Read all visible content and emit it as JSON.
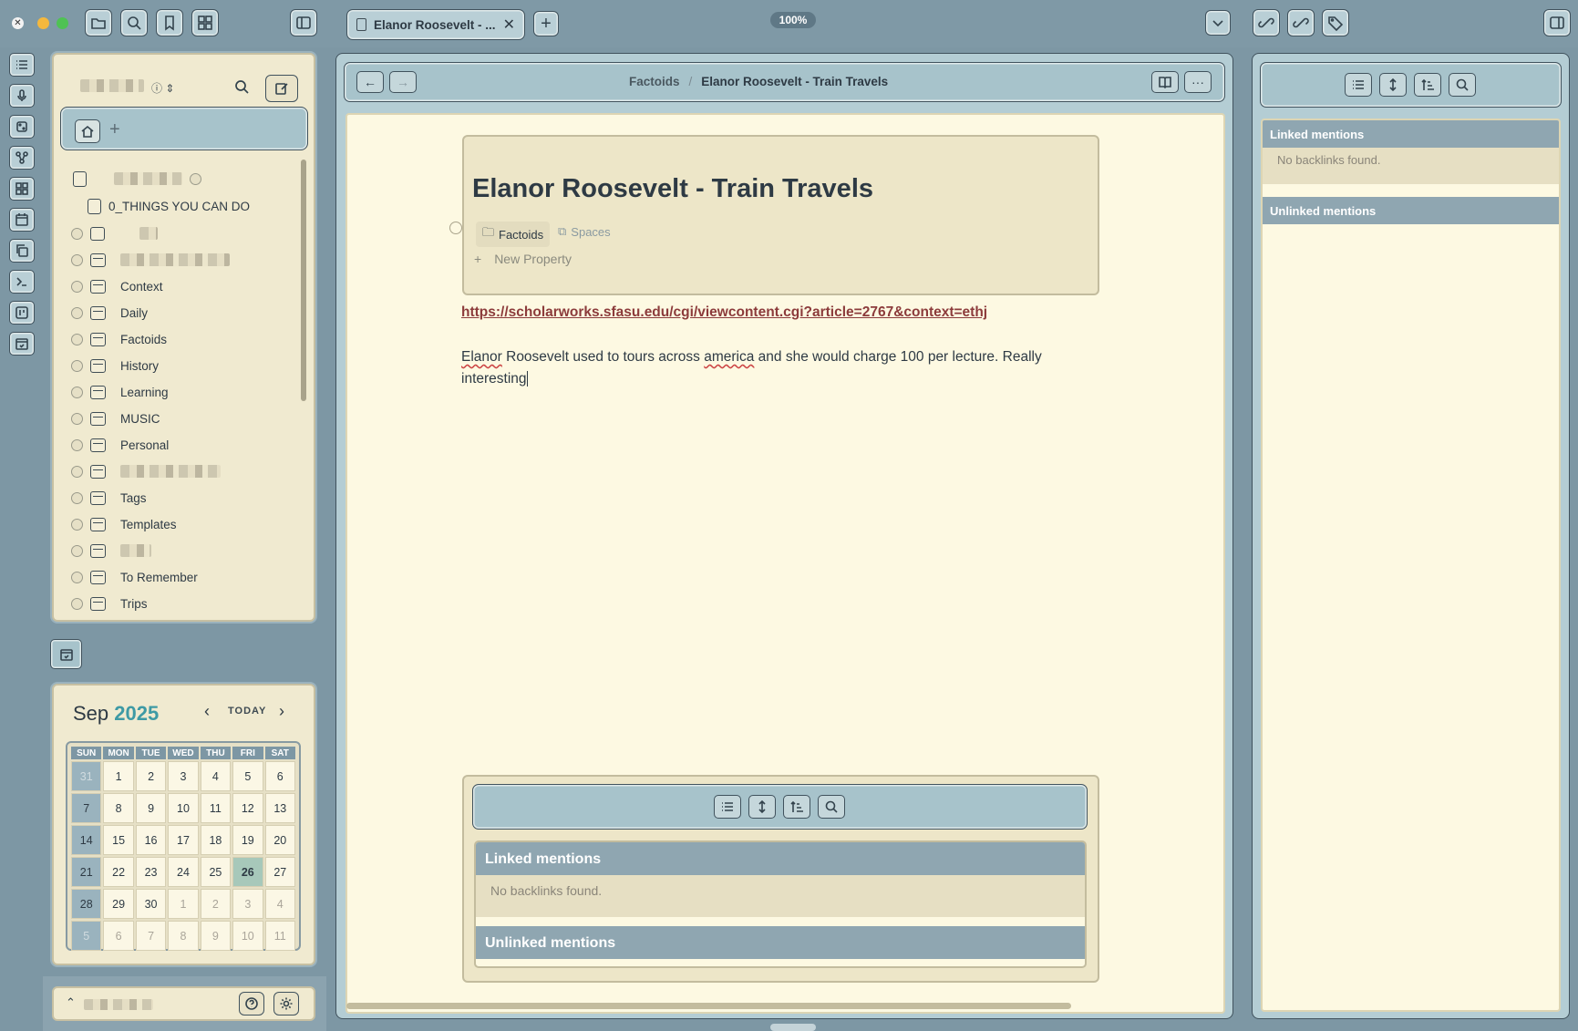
{
  "window": {
    "zoom": "100%",
    "tab_title": "Elanor Roosevelt - ...",
    "tab_close": "✕",
    "new_tab": "+"
  },
  "explorer": {
    "home_add": "+",
    "items": [
      {
        "label": "0_THINGS YOU CAN DO",
        "type": "page"
      },
      {
        "label": "Context",
        "type": "folder"
      },
      {
        "label": "Daily",
        "type": "folder"
      },
      {
        "label": "Factoids",
        "type": "folder"
      },
      {
        "label": "History",
        "type": "folder"
      },
      {
        "label": "Learning",
        "type": "folder"
      },
      {
        "label": "MUSIC",
        "type": "folder"
      },
      {
        "label": "Personal",
        "type": "folder"
      },
      {
        "label": "Tags",
        "type": "folder"
      },
      {
        "label": "Templates",
        "type": "folder"
      },
      {
        "label": "To Remember",
        "type": "folder"
      },
      {
        "label": "Trips",
        "type": "folder"
      }
    ]
  },
  "calendar": {
    "month": "Sep",
    "year": "2025",
    "today_label": "TODAY",
    "weekdays": [
      "SUN",
      "MON",
      "TUE",
      "WED",
      "THU",
      "FRI",
      "SAT"
    ],
    "weeks": [
      [
        "31",
        "1",
        "2",
        "3",
        "4",
        "5",
        "6"
      ],
      [
        "7",
        "8",
        "9",
        "10",
        "11",
        "12",
        "13"
      ],
      [
        "14",
        "15",
        "16",
        "17",
        "18",
        "19",
        "20"
      ],
      [
        "21",
        "22",
        "23",
        "24",
        "25",
        "26",
        "27"
      ],
      [
        "28",
        "29",
        "30",
        "1",
        "2",
        "3",
        "4"
      ],
      [
        "5",
        "6",
        "7",
        "8",
        "9",
        "10",
        "11"
      ]
    ],
    "today": "26"
  },
  "editor": {
    "breadcrumb_parent": "Factoids",
    "breadcrumb_sep": "/",
    "breadcrumb_current": "Elanor Roosevelt - Train Travels",
    "title": "Elanor Roosevelt - Train Travels",
    "tags": {
      "folder": "Factoids",
      "spaces": "Spaces"
    },
    "new_property": "New Property",
    "link": "https://scholarworks.sfasu.edu/cgi/viewcontent.cgi?article=2767&context=ethj",
    "body_pre": "Elanor",
    "body_mid1": " Roosevelt used to tours across ",
    "body_sq": "america",
    "body_post": " and she would charge 100 per lecture. Really interesting"
  },
  "backlinks": {
    "linked": "Linked mentions",
    "unlinked": "Unlinked mentions",
    "empty": "No backlinks found."
  }
}
